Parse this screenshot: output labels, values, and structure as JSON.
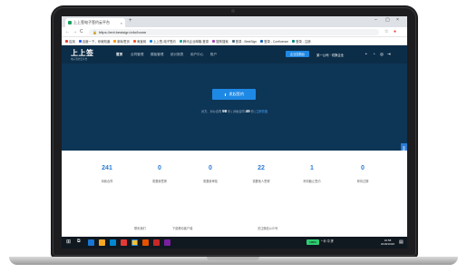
{
  "browser": {
    "tab_title": "上上签电子签约云平台",
    "tab_close": "×",
    "new_tab": "+",
    "window_controls": [
      "–",
      "▢",
      "×"
    ],
    "nav": [
      "←",
      "→",
      "C"
    ],
    "url": "https://ent.bestsign.info/home",
    "bookmarks": [
      "应用",
      "百度一下，你就知道",
      "新标签页",
      "淘宝网",
      "上上签-电子签约",
      "腾讯企业邮箱-登录",
      "搜狗搜索",
      "登录 - BestSign",
      "登录 - Confluence",
      "登录 - 注册"
    ]
  },
  "header": {
    "logo": "上上签",
    "logo_sub": "电子签约云平台",
    "nav_items": [
      "首页",
      "合同管理",
      "模板管理",
      "统计报表",
      "用户中心",
      "账户"
    ],
    "enterprise_button": "企业控制台",
    "company": "某一公司 · 切换企业",
    "icons": [
      "bell-icon",
      "help-icon",
      "logout-icon"
    ]
  },
  "hero": {
    "sign_button": "发起签约",
    "quota_prefix": "对方、对公合同",
    "quota_value": "98",
    "quota_unit": "份",
    "quota_sep": "|",
    "quota_prefix2": "对私合同",
    "quota_value2": "49",
    "quota_unit2": "份",
    "quota_link": "立即充值"
  },
  "side_float": "在线客服",
  "stats": [
    {
      "value": "241",
      "label": "待我合同"
    },
    {
      "value": "0",
      "label": "需要我签署"
    },
    {
      "value": "0",
      "label": "需要我审批"
    },
    {
      "value": "22",
      "label": "需要他人签署"
    },
    {
      "value": "1",
      "label": "即将截止签约"
    },
    {
      "value": "0",
      "label": "即将过期"
    }
  ],
  "footer": [
    "联系我们",
    "下载移动客户端",
    "关注微信公众号"
  ],
  "taskbar": {
    "battery": "100%",
    "tray": "^ ⊕ 中 拼",
    "time": "10:58",
    "date": "2018/10/26"
  },
  "colors": {
    "header_bg": "#0c2d48",
    "hero_bg": "#0d3556",
    "accent": "#1e88e5",
    "stat_number": "#2a7bd6"
  }
}
